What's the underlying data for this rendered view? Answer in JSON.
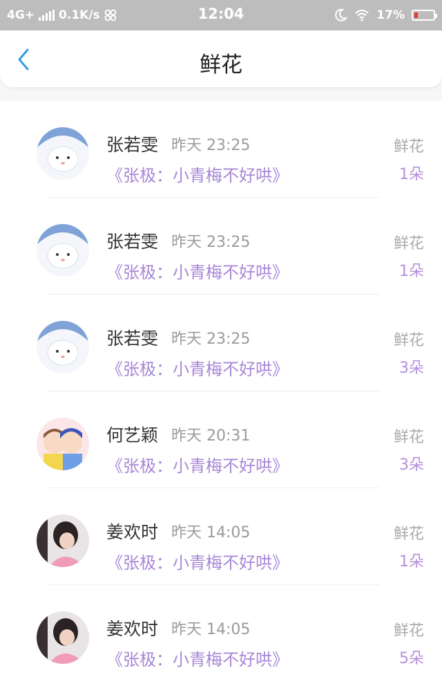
{
  "status": {
    "network": "4G+",
    "speed": "0.1K/s",
    "time": "12:04",
    "battery": "17%"
  },
  "header": {
    "title": "鲜花"
  },
  "records": [
    {
      "name": "张若雯",
      "time": "昨天 23:25",
      "work": "《张极：小青梅不好哄》",
      "gift": "鲜花",
      "count": "1朵"
    },
    {
      "name": "张若雯",
      "time": "昨天 23:25",
      "work": "《张极：小青梅不好哄》",
      "gift": "鲜花",
      "count": "1朵"
    },
    {
      "name": "张若雯",
      "time": "昨天 23:25",
      "work": "《张极：小青梅不好哄》",
      "gift": "鲜花",
      "count": "3朵"
    },
    {
      "name": "何艺颖",
      "time": "昨天 20:31",
      "work": "《张极：小青梅不好哄》",
      "gift": "鲜花",
      "count": "3朵"
    },
    {
      "name": "姜欢时",
      "time": "昨天 14:05",
      "work": "《张极：小青梅不好哄》",
      "gift": "鲜花",
      "count": "1朵"
    },
    {
      "name": "姜欢时",
      "time": "昨天 14:05",
      "work": "《张极：小青梅不好哄》",
      "gift": "鲜花",
      "count": "5朵"
    }
  ],
  "colors": {
    "accent_back": "#2f9ee8",
    "work_title": "#a787d6",
    "count": "#b48fdd"
  }
}
